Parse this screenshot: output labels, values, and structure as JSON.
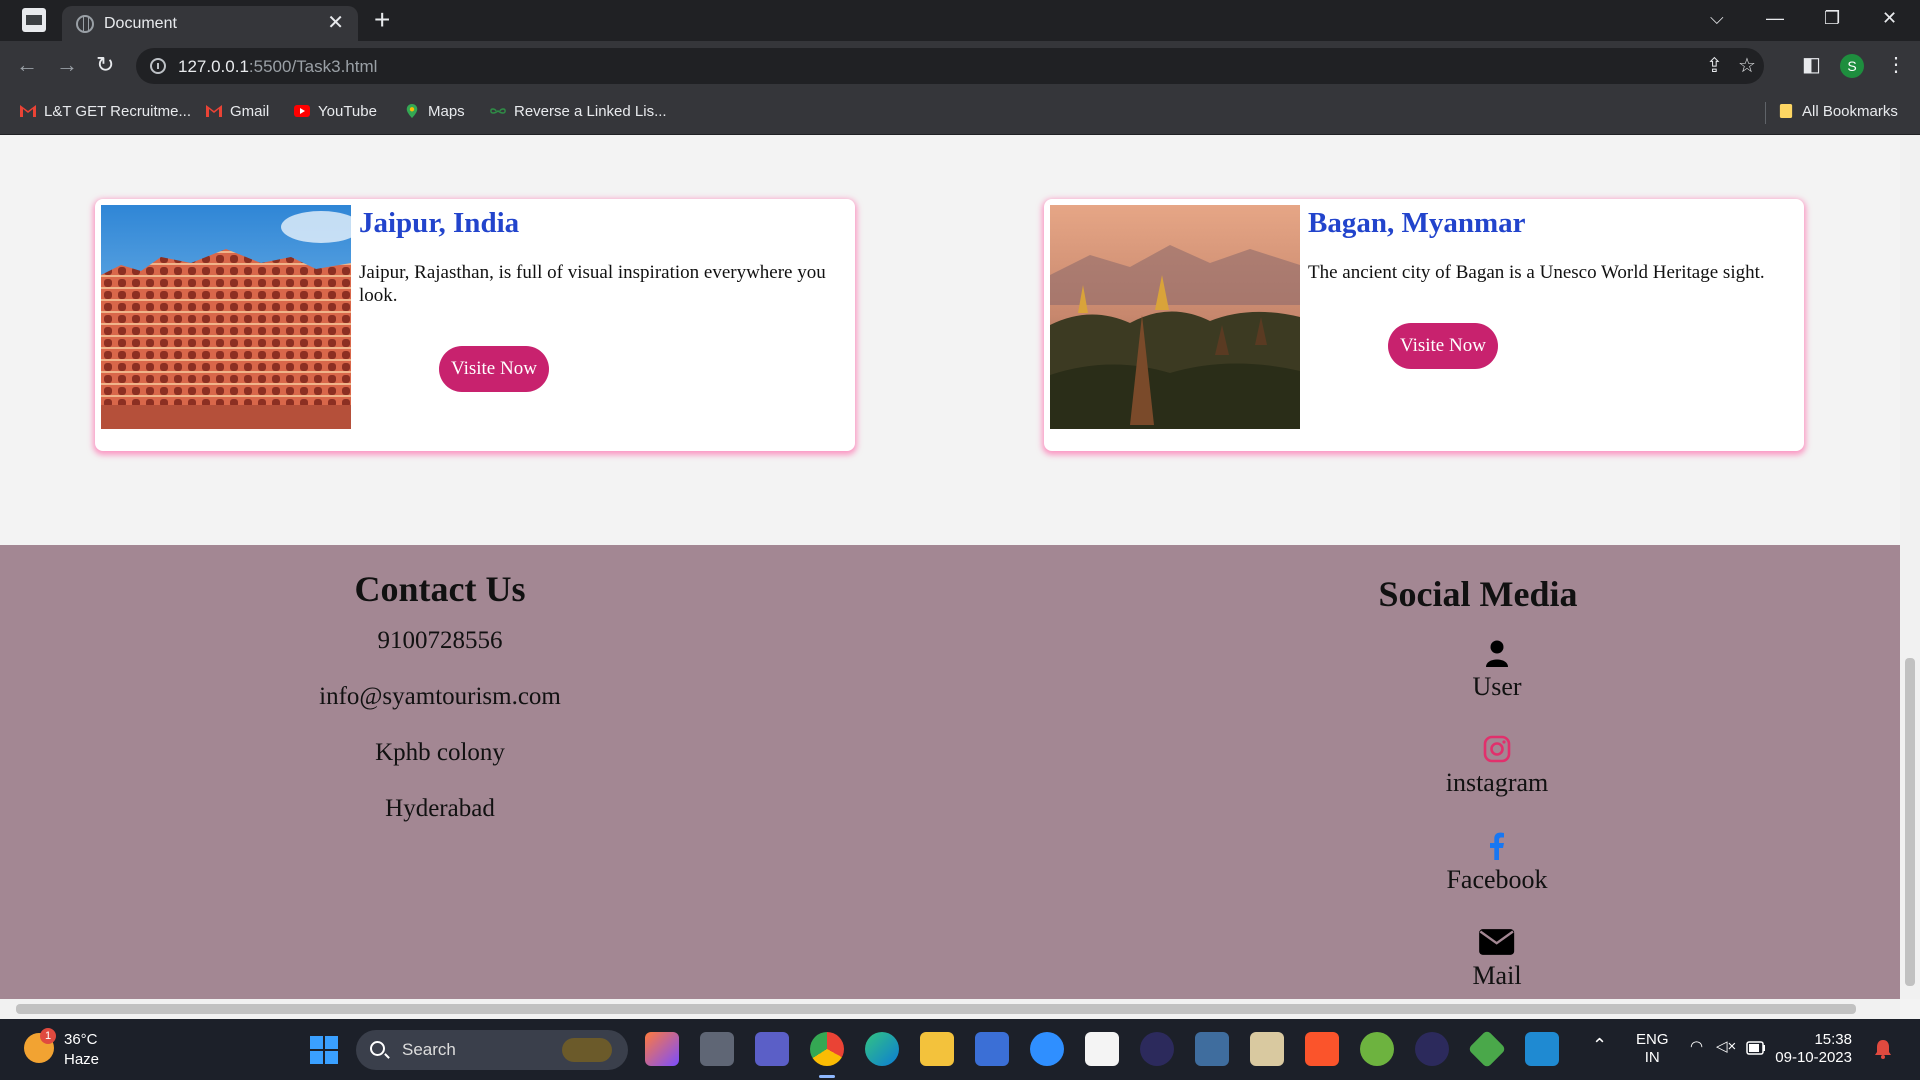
{
  "browser": {
    "tab_title": "Document",
    "close_glyph": "✕",
    "newtab_glyph": "+",
    "window_controls": {
      "chevron": "⌵",
      "minimize": "—",
      "restore": "❐",
      "close": "✕"
    },
    "url_host": "127.0.0.1",
    "url_path": ":5500/Task3.html",
    "profile_initial": "S",
    "nav": {
      "back": "←",
      "forward": "→",
      "reload": "↻"
    },
    "omni_icons": {
      "share": "⇪",
      "star": "☆"
    },
    "toolbar_icons": {
      "sidepanel": "◧",
      "menu": "⋮"
    }
  },
  "bookmarks": [
    {
      "label": "L&T GET Recruitme...",
      "icon": "gmail-icon",
      "color": "#ea4335"
    },
    {
      "label": "Gmail",
      "icon": "gmail-icon",
      "color": "#ea4335"
    },
    {
      "label": "YouTube",
      "icon": "youtube-icon",
      "color": "#ff0000"
    },
    {
      "label": "Maps",
      "icon": "maps-pin-icon",
      "color": "#34a853"
    },
    {
      "label": "Reverse a Linked Lis...",
      "icon": "gfg-icon",
      "color": "#2f8d46"
    },
    {
      "label": "All Bookmarks",
      "icon": "folder-icon",
      "color": "#fdd663"
    }
  ],
  "cards": [
    {
      "title": "Jaipur, India",
      "description": "Jaipur, Rajasthan, is full of visual inspiration everywhere you look.",
      "button": "Visite Now"
    },
    {
      "title": "Bagan, Myanmar",
      "description": "The ancient city of Bagan is a Unesco World Heritage sight.",
      "button": "Visite Now"
    }
  ],
  "footer": {
    "contact_title": "Contact Us",
    "contact_lines": [
      "9100728556",
      "info@syamtourism.com",
      "Kphb colony",
      "Hyderabad"
    ],
    "social_title": "Social Media",
    "social": [
      {
        "label": "User",
        "icon": "user-icon",
        "color": "#000000"
      },
      {
        "label": "instagram",
        "icon": "instagram-icon",
        "color": "#e1306c"
      },
      {
        "label": "Facebook",
        "icon": "facebook-icon",
        "color": "#1877f2"
      },
      {
        "label": "Mail",
        "icon": "mail-icon",
        "color": "#000000"
      }
    ]
  },
  "taskbar": {
    "weather_temp": "36°C",
    "weather_desc": "Haze",
    "weather_badge": "1",
    "search_placeholder": "Search",
    "lang_line1": "ENG",
    "lang_line2": "IN",
    "time": "15:38",
    "date": "09-10-2023",
    "tray_icons": {
      "chevron": "⌃",
      "wifi": "◠",
      "volume": "◁×"
    }
  },
  "colors": {
    "accent_blue": "#2244cc",
    "button_pink": "#c8226e",
    "footer_bg": "#a38793",
    "card_glow": "#ff69aa"
  }
}
